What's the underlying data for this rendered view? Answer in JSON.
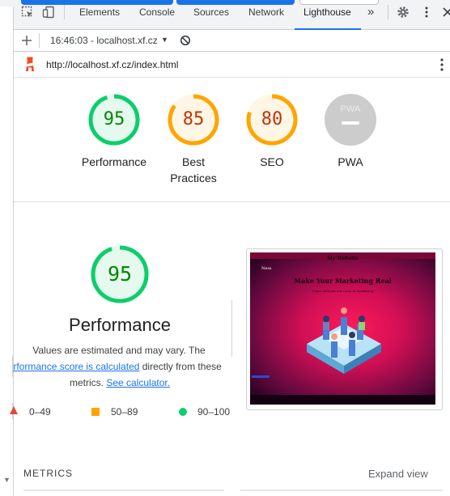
{
  "tabs": {
    "elements": "Elements",
    "console": "Console",
    "sources": "Sources",
    "network": "Network",
    "lighthouse": "Lighthouse",
    "more": "»"
  },
  "toolbar": {
    "report_selector": "16:46:03 - localhost.xf.cz",
    "url": "http://localhost.xf.cz/index.html"
  },
  "scores": [
    {
      "value": "95",
      "label_line1": "Performance",
      "label_line2": "",
      "status": "pass",
      "fraction": 0.95
    },
    {
      "value": "85",
      "label_line1": "Best",
      "label_line2": "Practices",
      "status": "average",
      "fraction": 0.85
    },
    {
      "value": "80",
      "label_line1": "SEO",
      "label_line2": "",
      "status": "average",
      "fraction": 0.8
    },
    {
      "value": "",
      "label_line1": "PWA",
      "label_line2": "",
      "status": "na",
      "badge": "PWA"
    }
  ],
  "performance": {
    "score": "95",
    "title": "Performance",
    "desc_line1": "Values are estimated and may vary. The",
    "link1": "performance score is calculated",
    "desc_line2_after": " directly from these",
    "desc_line3_before": "metrics. ",
    "link2": "See calculator.",
    "fraction": 0.95
  },
  "legend": [
    {
      "range": "0–49",
      "shape": "triangle",
      "color": "#e8453c"
    },
    {
      "range": "50–89",
      "shape": "square",
      "color": "#ffa400"
    },
    {
      "range": "90–100",
      "shape": "circle",
      "color": "#0cce6b"
    }
  ],
  "screenshot": {
    "site_title": "My Website",
    "logo_text": "Ness",
    "headline": "Make Your Marketing Real",
    "subline": "Come and join our team in marketing"
  },
  "metrics": {
    "label": "METRICS",
    "expand": "Expand view"
  },
  "colors": {
    "pass": "#0cce6b",
    "pass_text": "#008800",
    "pass_bg": "#e6f9ef",
    "average": "#ffa400",
    "average_text": "#c33300",
    "average_bg": "#fff6e6",
    "na": "#cccccc",
    "accent": "#1a73e8"
  }
}
